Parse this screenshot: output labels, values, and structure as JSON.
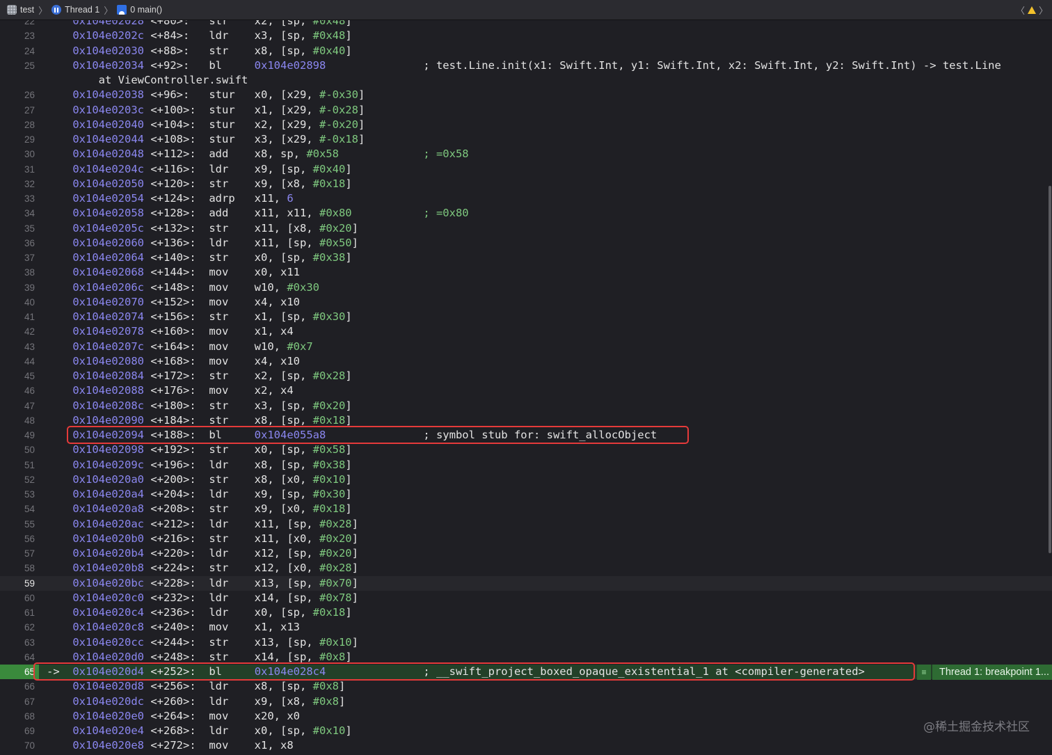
{
  "jumpbar": {
    "items": [
      {
        "label": "test",
        "icon": "app-icon"
      },
      {
        "label": "Thread 1",
        "icon": "thread-icon"
      },
      {
        "label": "0 main()",
        "icon": "stack-frame-icon"
      }
    ]
  },
  "breakpoint": {
    "label": "Thread 1: breakpoint 1..."
  },
  "watermark": "@稀土掘金技术社区",
  "current_line": "59",
  "pc_line": "65",
  "lines": [
    {
      "n": "22",
      "addr": "0x104e02028",
      "off": "<+80>:",
      "mn": "str",
      "ops": [
        [
          "x2, [sp, ",
          0
        ],
        [
          "#0x48",
          1
        ],
        [
          "]",
          0
        ]
      ],
      "cmt": ""
    },
    {
      "n": "23",
      "addr": "0x104e0202c",
      "off": "<+84>:",
      "mn": "ldr",
      "ops": [
        [
          "x3, [sp, ",
          0
        ],
        [
          "#0x48",
          1
        ],
        [
          "]",
          0
        ]
      ],
      "cmt": ""
    },
    {
      "n": "24",
      "addr": "0x104e02030",
      "off": "<+88>:",
      "mn": "str",
      "ops": [
        [
          "x8, [sp, ",
          0
        ],
        [
          "#0x40",
          1
        ],
        [
          "]",
          0
        ]
      ],
      "cmt": ""
    },
    {
      "n": "25",
      "addr": "0x104e02034",
      "off": "<+92>:",
      "mn": "bl",
      "ops": [
        [
          "0x104e02898",
          2
        ]
      ],
      "cmt": "; test.Line.init(x1: Swift.Int, y1: Swift.Int, x2: Swift.Int, y2: Swift.Int) -> test.Line"
    },
    {
      "n": "",
      "cont": "at ViewController.swift"
    },
    {
      "n": "26",
      "addr": "0x104e02038",
      "off": "<+96>:",
      "mn": "stur",
      "ops": [
        [
          "x0, [x29, ",
          0
        ],
        [
          "#-0x30",
          1
        ],
        [
          "]",
          0
        ]
      ],
      "cmt": ""
    },
    {
      "n": "27",
      "addr": "0x104e0203c",
      "off": "<+100>:",
      "mn": "stur",
      "ops": [
        [
          "x1, [x29, ",
          0
        ],
        [
          "#-0x28",
          1
        ],
        [
          "]",
          0
        ]
      ],
      "cmt": ""
    },
    {
      "n": "28",
      "addr": "0x104e02040",
      "off": "<+104>:",
      "mn": "stur",
      "ops": [
        [
          "x2, [x29, ",
          0
        ],
        [
          "#-0x20",
          1
        ],
        [
          "]",
          0
        ]
      ],
      "cmt": ""
    },
    {
      "n": "29",
      "addr": "0x104e02044",
      "off": "<+108>:",
      "mn": "stur",
      "ops": [
        [
          "x3, [x29, ",
          0
        ],
        [
          "#-0x18",
          1
        ],
        [
          "]",
          0
        ]
      ],
      "cmt": ""
    },
    {
      "n": "30",
      "addr": "0x104e02048",
      "off": "<+112>:",
      "mn": "add",
      "ops": [
        [
          "x8, sp, ",
          0
        ],
        [
          "#0x58",
          1
        ]
      ],
      "cmt": "; =0x58",
      "cmtc": 1
    },
    {
      "n": "31",
      "addr": "0x104e0204c",
      "off": "<+116>:",
      "mn": "ldr",
      "ops": [
        [
          "x9, [sp, ",
          0
        ],
        [
          "#0x40",
          1
        ],
        [
          "]",
          0
        ]
      ],
      "cmt": ""
    },
    {
      "n": "32",
      "addr": "0x104e02050",
      "off": "<+120>:",
      "mn": "str",
      "ops": [
        [
          "x9, [x8, ",
          0
        ],
        [
          "#0x18",
          1
        ],
        [
          "]",
          0
        ]
      ],
      "cmt": ""
    },
    {
      "n": "33",
      "addr": "0x104e02054",
      "off": "<+124>:",
      "mn": "adrp",
      "ops": [
        [
          "x11, ",
          0
        ],
        [
          "6",
          2
        ]
      ],
      "cmt": ""
    },
    {
      "n": "34",
      "addr": "0x104e02058",
      "off": "<+128>:",
      "mn": "add",
      "ops": [
        [
          "x11, x11, ",
          0
        ],
        [
          "#0x80",
          1
        ]
      ],
      "cmt": "; =0x80",
      "cmtc": 1
    },
    {
      "n": "35",
      "addr": "0x104e0205c",
      "off": "<+132>:",
      "mn": "str",
      "ops": [
        [
          "x11, [x8, ",
          0
        ],
        [
          "#0x20",
          1
        ],
        [
          "]",
          0
        ]
      ],
      "cmt": ""
    },
    {
      "n": "36",
      "addr": "0x104e02060",
      "off": "<+136>:",
      "mn": "ldr",
      "ops": [
        [
          "x11, [sp, ",
          0
        ],
        [
          "#0x50",
          1
        ],
        [
          "]",
          0
        ]
      ],
      "cmt": ""
    },
    {
      "n": "37",
      "addr": "0x104e02064",
      "off": "<+140>:",
      "mn": "str",
      "ops": [
        [
          "x0, [sp, ",
          0
        ],
        [
          "#0x38",
          1
        ],
        [
          "]",
          0
        ]
      ],
      "cmt": ""
    },
    {
      "n": "38",
      "addr": "0x104e02068",
      "off": "<+144>:",
      "mn": "mov",
      "ops": [
        [
          "x0, x11",
          0
        ]
      ],
      "cmt": ""
    },
    {
      "n": "39",
      "addr": "0x104e0206c",
      "off": "<+148>:",
      "mn": "mov",
      "ops": [
        [
          "w10, ",
          0
        ],
        [
          "#0x30",
          1
        ]
      ],
      "cmt": ""
    },
    {
      "n": "40",
      "addr": "0x104e02070",
      "off": "<+152>:",
      "mn": "mov",
      "ops": [
        [
          "x4, x10",
          0
        ]
      ],
      "cmt": ""
    },
    {
      "n": "41",
      "addr": "0x104e02074",
      "off": "<+156>:",
      "mn": "str",
      "ops": [
        [
          "x1, [sp, ",
          0
        ],
        [
          "#0x30",
          1
        ],
        [
          "]",
          0
        ]
      ],
      "cmt": ""
    },
    {
      "n": "42",
      "addr": "0x104e02078",
      "off": "<+160>:",
      "mn": "mov",
      "ops": [
        [
          "x1, x4",
          0
        ]
      ],
      "cmt": ""
    },
    {
      "n": "43",
      "addr": "0x104e0207c",
      "off": "<+164>:",
      "mn": "mov",
      "ops": [
        [
          "w10, ",
          0
        ],
        [
          "#0x7",
          1
        ]
      ],
      "cmt": ""
    },
    {
      "n": "44",
      "addr": "0x104e02080",
      "off": "<+168>:",
      "mn": "mov",
      "ops": [
        [
          "x4, x10",
          0
        ]
      ],
      "cmt": ""
    },
    {
      "n": "45",
      "addr": "0x104e02084",
      "off": "<+172>:",
      "mn": "str",
      "ops": [
        [
          "x2, [sp, ",
          0
        ],
        [
          "#0x28",
          1
        ],
        [
          "]",
          0
        ]
      ],
      "cmt": ""
    },
    {
      "n": "46",
      "addr": "0x104e02088",
      "off": "<+176>:",
      "mn": "mov",
      "ops": [
        [
          "x2, x4",
          0
        ]
      ],
      "cmt": ""
    },
    {
      "n": "47",
      "addr": "0x104e0208c",
      "off": "<+180>:",
      "mn": "str",
      "ops": [
        [
          "x3, [sp, ",
          0
        ],
        [
          "#0x20",
          1
        ],
        [
          "]",
          0
        ]
      ],
      "cmt": ""
    },
    {
      "n": "48",
      "addr": "0x104e02090",
      "off": "<+184>:",
      "mn": "str",
      "ops": [
        [
          "x8, [sp, ",
          0
        ],
        [
          "#0x18",
          1
        ],
        [
          "]",
          0
        ]
      ],
      "cmt": ""
    },
    {
      "n": "49",
      "addr": "0x104e02094",
      "off": "<+188>:",
      "mn": "bl",
      "ops": [
        [
          "0x104e055a8",
          2
        ]
      ],
      "cmt": "; symbol stub for: swift_allocObject",
      "hl": true
    },
    {
      "n": "50",
      "addr": "0x104e02098",
      "off": "<+192>:",
      "mn": "str",
      "ops": [
        [
          "x0, [sp, ",
          0
        ],
        [
          "#0x58",
          1
        ],
        [
          "]",
          0
        ]
      ],
      "cmt": ""
    },
    {
      "n": "51",
      "addr": "0x104e0209c",
      "off": "<+196>:",
      "mn": "ldr",
      "ops": [
        [
          "x8, [sp, ",
          0
        ],
        [
          "#0x38",
          1
        ],
        [
          "]",
          0
        ]
      ],
      "cmt": ""
    },
    {
      "n": "52",
      "addr": "0x104e020a0",
      "off": "<+200>:",
      "mn": "str",
      "ops": [
        [
          "x8, [x0, ",
          0
        ],
        [
          "#0x10",
          1
        ],
        [
          "]",
          0
        ]
      ],
      "cmt": ""
    },
    {
      "n": "53",
      "addr": "0x104e020a4",
      "off": "<+204>:",
      "mn": "ldr",
      "ops": [
        [
          "x9, [sp, ",
          0
        ],
        [
          "#0x30",
          1
        ],
        [
          "]",
          0
        ]
      ],
      "cmt": ""
    },
    {
      "n": "54",
      "addr": "0x104e020a8",
      "off": "<+208>:",
      "mn": "str",
      "ops": [
        [
          "x9, [x0, ",
          0
        ],
        [
          "#0x18",
          1
        ],
        [
          "]",
          0
        ]
      ],
      "cmt": ""
    },
    {
      "n": "55",
      "addr": "0x104e020ac",
      "off": "<+212>:",
      "mn": "ldr",
      "ops": [
        [
          "x11, [sp, ",
          0
        ],
        [
          "#0x28",
          1
        ],
        [
          "]",
          0
        ]
      ],
      "cmt": ""
    },
    {
      "n": "56",
      "addr": "0x104e020b0",
      "off": "<+216>:",
      "mn": "str",
      "ops": [
        [
          "x11, [x0, ",
          0
        ],
        [
          "#0x20",
          1
        ],
        [
          "]",
          0
        ]
      ],
      "cmt": ""
    },
    {
      "n": "57",
      "addr": "0x104e020b4",
      "off": "<+220>:",
      "mn": "ldr",
      "ops": [
        [
          "x12, [sp, ",
          0
        ],
        [
          "#0x20",
          1
        ],
        [
          "]",
          0
        ]
      ],
      "cmt": ""
    },
    {
      "n": "58",
      "addr": "0x104e020b8",
      "off": "<+224>:",
      "mn": "str",
      "ops": [
        [
          "x12, [x0, ",
          0
        ],
        [
          "#0x28",
          1
        ],
        [
          "]",
          0
        ]
      ],
      "cmt": ""
    },
    {
      "n": "59",
      "addr": "0x104e020bc",
      "off": "<+228>:",
      "mn": "ldr",
      "ops": [
        [
          "x13, [sp, ",
          0
        ],
        [
          "#0x70",
          1
        ],
        [
          "]",
          0
        ]
      ],
      "cmt": ""
    },
    {
      "n": "60",
      "addr": "0x104e020c0",
      "off": "<+232>:",
      "mn": "ldr",
      "ops": [
        [
          "x14, [sp, ",
          0
        ],
        [
          "#0x78",
          1
        ],
        [
          "]",
          0
        ]
      ],
      "cmt": ""
    },
    {
      "n": "61",
      "addr": "0x104e020c4",
      "off": "<+236>:",
      "mn": "ldr",
      "ops": [
        [
          "x0, [sp, ",
          0
        ],
        [
          "#0x18",
          1
        ],
        [
          "]",
          0
        ]
      ],
      "cmt": ""
    },
    {
      "n": "62",
      "addr": "0x104e020c8",
      "off": "<+240>:",
      "mn": "mov",
      "ops": [
        [
          "x1, x13",
          0
        ]
      ],
      "cmt": ""
    },
    {
      "n": "63",
      "addr": "0x104e020cc",
      "off": "<+244>:",
      "mn": "str",
      "ops": [
        [
          "x13, [sp, ",
          0
        ],
        [
          "#0x10",
          1
        ],
        [
          "]",
          0
        ]
      ],
      "cmt": ""
    },
    {
      "n": "64",
      "addr": "0x104e020d0",
      "off": "<+248>:",
      "mn": "str",
      "ops": [
        [
          "x14, [sp, ",
          0
        ],
        [
          "#0x8",
          1
        ],
        [
          "]",
          0
        ]
      ],
      "cmt": ""
    },
    {
      "n": "65",
      "addr": "0x104e020d4",
      "off": "<+252>:",
      "mn": "bl",
      "ops": [
        [
          "0x104e028c4",
          2
        ]
      ],
      "cmt": "; __swift_project_boxed_opaque_existential_1 at <compiler-generated>",
      "arrow": "->",
      "hl": true
    },
    {
      "n": "66",
      "addr": "0x104e020d8",
      "off": "<+256>:",
      "mn": "ldr",
      "ops": [
        [
          "x8, [sp, ",
          0
        ],
        [
          "#0x8",
          1
        ],
        [
          "]",
          0
        ]
      ],
      "cmt": ""
    },
    {
      "n": "67",
      "addr": "0x104e020dc",
      "off": "<+260>:",
      "mn": "ldr",
      "ops": [
        [
          "x9, [x8, ",
          0
        ],
        [
          "#0x8",
          1
        ],
        [
          "]",
          0
        ]
      ],
      "cmt": ""
    },
    {
      "n": "68",
      "addr": "0x104e020e0",
      "off": "<+264>:",
      "mn": "mov",
      "ops": [
        [
          "x20, x0",
          0
        ]
      ],
      "cmt": ""
    },
    {
      "n": "69",
      "addr": "0x104e020e4",
      "off": "<+268>:",
      "mn": "ldr",
      "ops": [
        [
          "x0, [sp, ",
          0
        ],
        [
          "#0x10",
          1
        ],
        [
          "]",
          0
        ]
      ],
      "cmt": ""
    },
    {
      "n": "70",
      "addr": "0x104e020e8",
      "off": "<+272>:",
      "mn": "mov",
      "ops": [
        [
          "x1, x8",
          0
        ]
      ],
      "cmt": ""
    }
  ]
}
